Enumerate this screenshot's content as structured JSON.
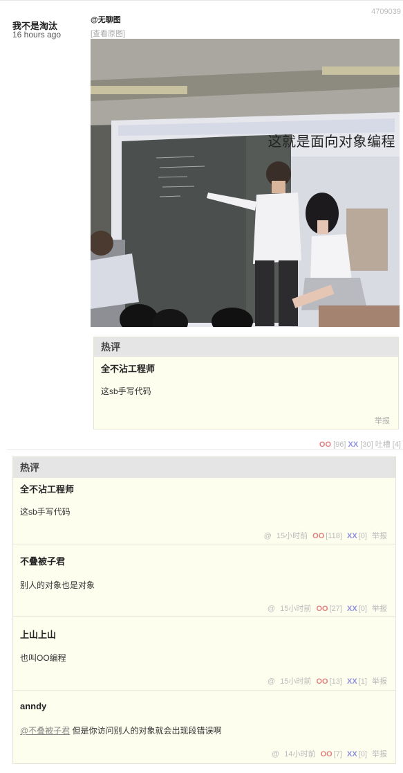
{
  "post": {
    "author": "我不是淘汰",
    "time": "16 hours ago",
    "id": "4709039",
    "source": "@无聊图",
    "view_original": "[查看原图]",
    "image_caption": "这就是面向对象编程",
    "votes": {
      "oo_label": "OO",
      "oo_count": "[96]",
      "xx_label": "XX",
      "xx_count": "[30]",
      "tucao": "吐槽 [4]"
    }
  },
  "inline_hot": {
    "header": "热评",
    "name": "全不沾工程师",
    "text": "这sb手写代码",
    "report": "举报"
  },
  "comments": {
    "header": "热评",
    "items": [
      {
        "name": "全不沾工程师",
        "text": "这sb手写代码",
        "at": "@",
        "time": "15小时前",
        "oo_label": "OO",
        "oo": "[118]",
        "xx_label": "XX",
        "xx": "[0]",
        "report": "举报"
      },
      {
        "name": "不叠被子君",
        "text": "别人的对象也是对象",
        "at": "@",
        "time": "15小时前",
        "oo_label": "OO",
        "oo": "[27]",
        "xx_label": "XX",
        "xx": "[0]",
        "report": "举报"
      },
      {
        "name": "上山上山",
        "text": "也叫OO编程",
        "at": "@",
        "time": "15小时前",
        "oo_label": "OO",
        "oo": "[13]",
        "xx_label": "XX",
        "xx": "[1]",
        "report": "举报"
      },
      {
        "name": "anndy",
        "mention": "@不叠被子君",
        "text": "但是你访问别人的对象就会出现段错误啊",
        "at": "@",
        "time": "14小时前",
        "oo_label": "OO",
        "oo": "[7]",
        "xx_label": "XX",
        "xx": "[0]",
        "report": "举报"
      }
    ]
  }
}
